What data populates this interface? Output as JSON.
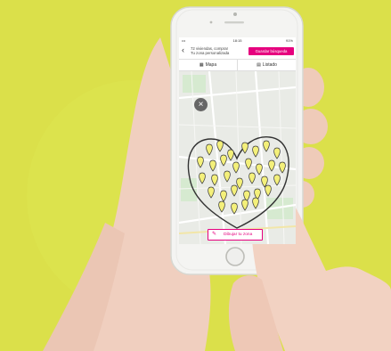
{
  "status_bar": {
    "signal": "•••",
    "time": "18:15",
    "battery": "91%"
  },
  "header": {
    "back_icon": "chevron-left-icon",
    "title_line1": "72 viviendas, comprar",
    "title_line2": "Tu zona personalizada",
    "save_label": "Guardar búsqueda"
  },
  "tabs": {
    "map_label": "Mapa",
    "map_icon": "map-icon",
    "list_label": "Listado",
    "list_icon": "list-icon"
  },
  "map": {
    "close_icon": "close-icon",
    "marker_color": "#f4f07a",
    "zone_outline_color": "#333333"
  },
  "draw_button": {
    "label": "Dibujar tu zona",
    "icon": "pencil-icon"
  },
  "colors": {
    "background": "#dbe04a",
    "accent": "#e6007e",
    "skin": "#f0cfbf",
    "phone_body": "#f4f4f2"
  }
}
